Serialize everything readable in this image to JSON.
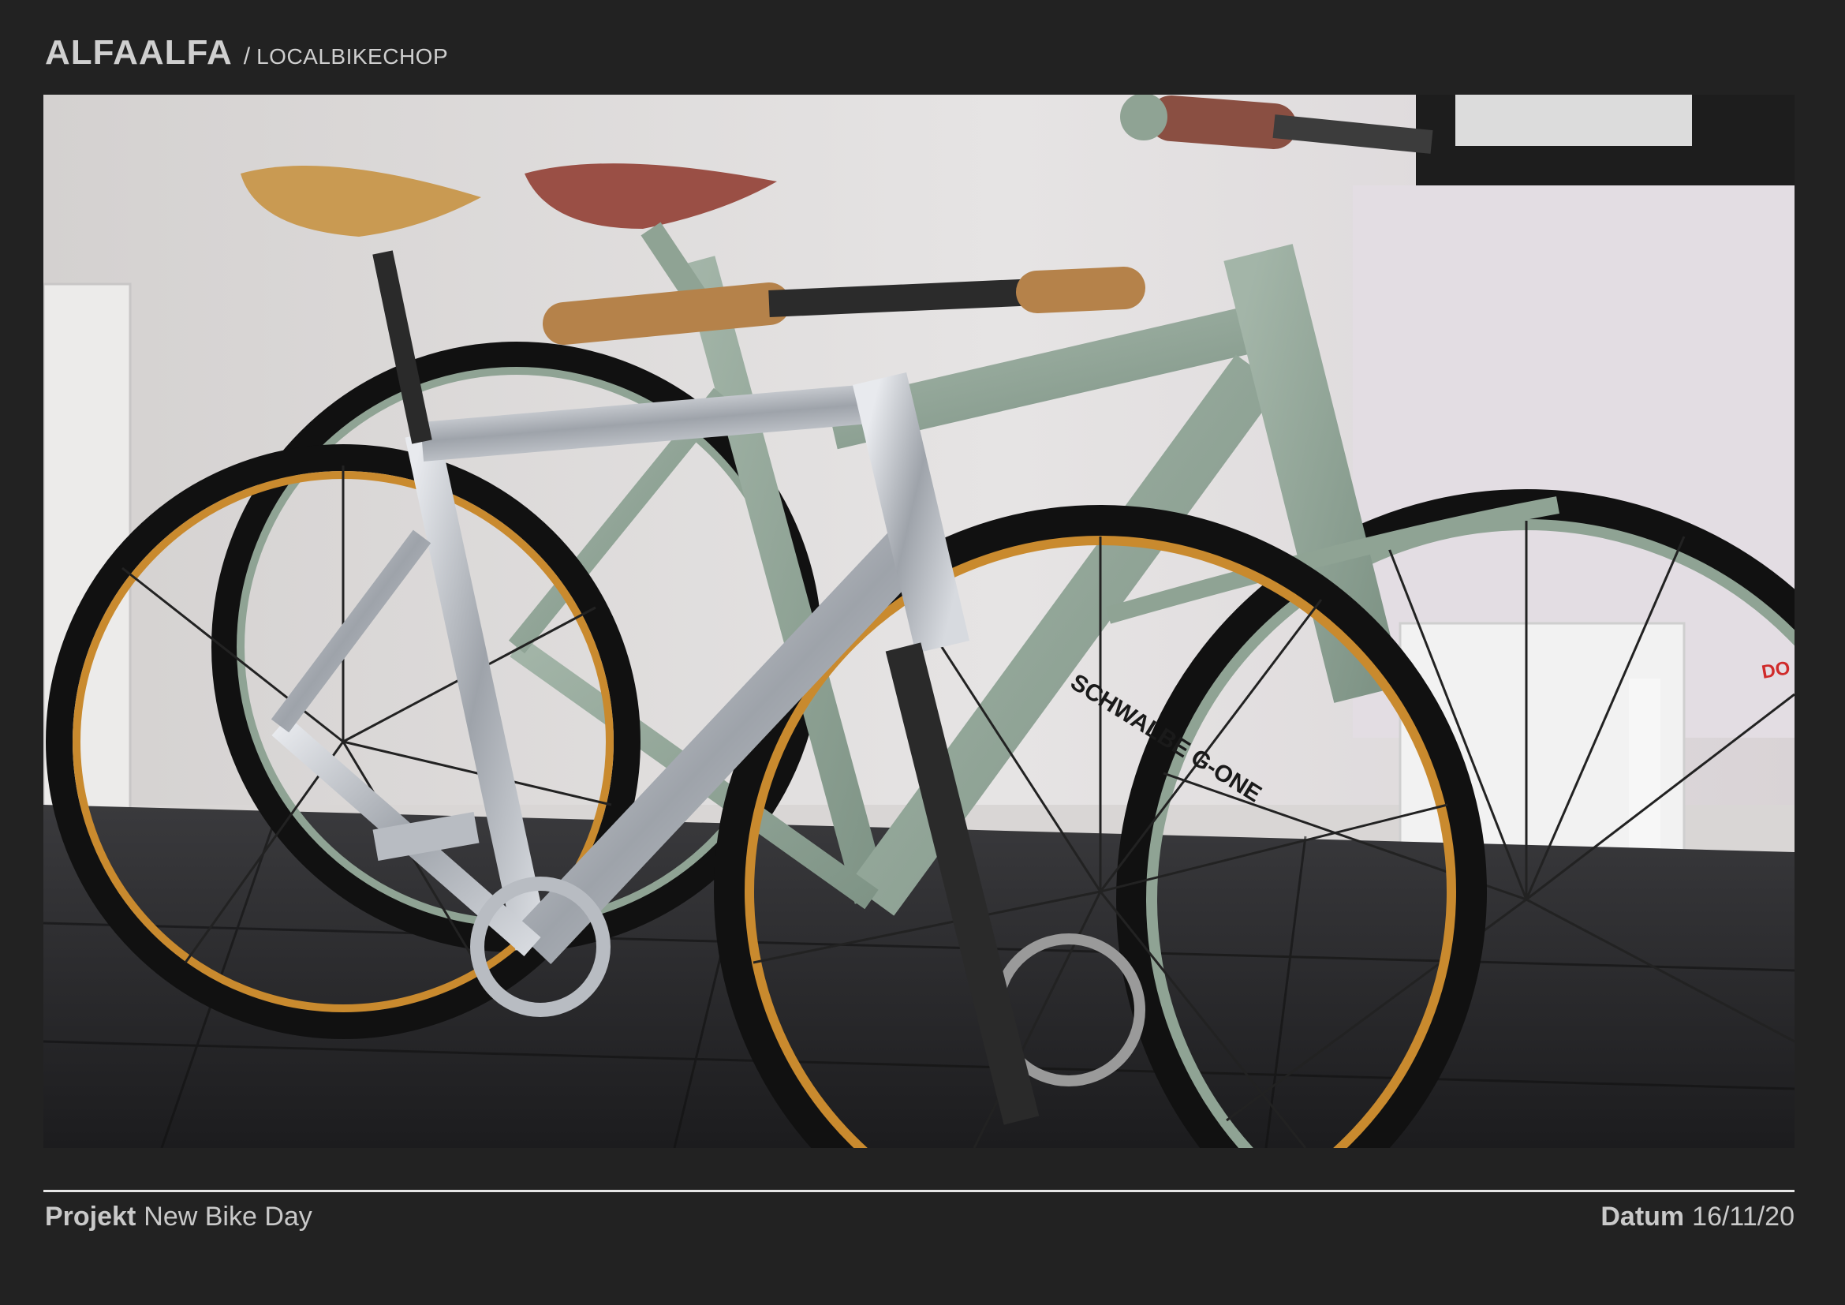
{
  "header": {
    "brand": "ALFAALFA",
    "separator": "/",
    "shop": "LOCALBIKECHOP"
  },
  "photo": {
    "tire_text_front": "SCHWALBE G-ONE",
    "tire_text_rear": "DO"
  },
  "footer": {
    "project_label": "Projekt",
    "project_value": "New Bike Day",
    "date_label": "Datum",
    "date_value": "16/11/20"
  },
  "colors": {
    "background": "#222222",
    "text": "#cfcfcf",
    "rule": "#e6e6e6",
    "sage_frame": "#8fa394",
    "aluminium": "#b8bcc2",
    "tan_sidewall": "#c98a2e",
    "saddle_honey": "#c99a52",
    "saddle_brown": "#9a4f45"
  }
}
